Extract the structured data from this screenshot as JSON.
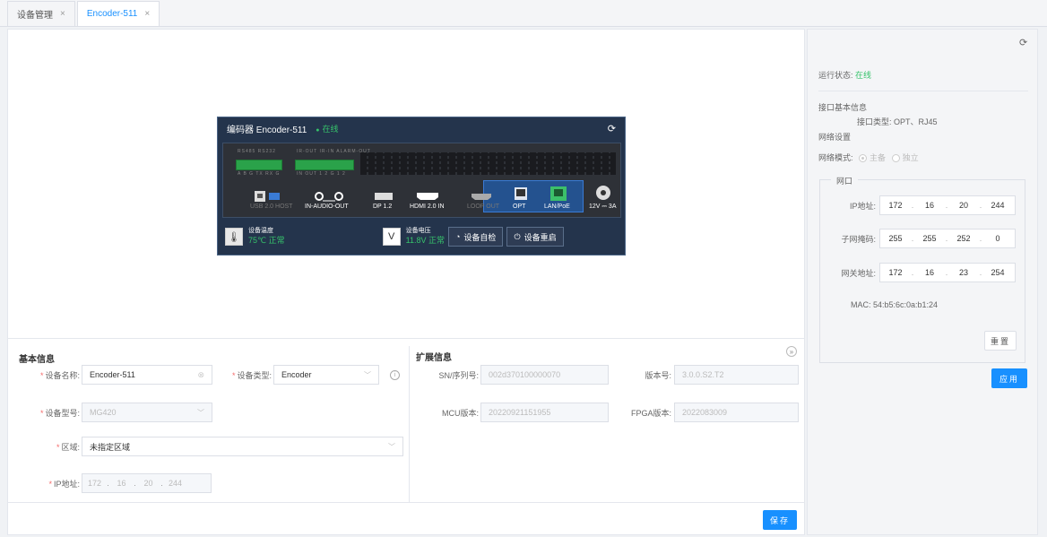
{
  "tabs": [
    {
      "label": "设备管理",
      "close": "×"
    },
    {
      "label": "Encoder-511",
      "close": "×"
    }
  ],
  "device": {
    "title": "编码器 Encoder-511",
    "status": "在线",
    "terminals": [
      {
        "top": "RS485 RS232",
        "bottom": "A B G TX RX G"
      },
      {
        "top": "IR-OUT IR-IN ALARM-OUT",
        "bottom": "IN OUT 1 2 G 1 2"
      }
    ],
    "ports": {
      "usb": "USB 2.0 HOST",
      "audio": "IN-AUDIO-OUT",
      "dp": "DP 1.2",
      "hdmi": "HDMI 2.0 IN",
      "loop": "LOOP OUT",
      "opt": "OPT",
      "lan": "LAN/PoE",
      "power": "12V ⎓ 3A"
    },
    "temp_label": "设备温度",
    "temp_value": "75℃ 正常",
    "volt_label": "设备电压",
    "volt_value": "11.8V 正常",
    "selfcheck_label": "设备自检",
    "reboot_label": "设备重启"
  },
  "basic": {
    "title": "基本信息",
    "name_label": "设备名称:",
    "name_value": "Encoder-511",
    "type_label": "设备类型:",
    "type_value": "Encoder",
    "model_label": "设备型号:",
    "model_value": "MG420",
    "region_label": "区域:",
    "region_value": "未指定区域",
    "ip_label": "IP地址:",
    "ip": [
      "172",
      "16",
      "20",
      "244"
    ]
  },
  "ext": {
    "title": "扩展信息",
    "sn_label": "SN/序列号:",
    "sn_value": "002d370100000070",
    "ver_label": "版本号:",
    "ver_value": "3.0.0.S2.T2",
    "mcu_label": "MCU版本:",
    "mcu_value": "20220921151955",
    "fpga_label": "FPGA版本:",
    "fpga_value": "2022083009"
  },
  "save_label": "保存",
  "side": {
    "run_label": "运行状态:",
    "run_value": "在线",
    "if_title": "接口基本信息",
    "if_type": "接口类型: OPT、RJ45",
    "net_title": "网络设置",
    "mode_label": "网络模式:",
    "mode_options": [
      "主备",
      "独立"
    ],
    "port_legend": "网口",
    "ip_label": "IP地址:",
    "ip": [
      "172",
      "16",
      "20",
      "244"
    ],
    "mask_label": "子网掩码:",
    "mask": [
      "255",
      "255",
      "252",
      "0"
    ],
    "gw_label": "网关地址:",
    "gw": [
      "172",
      "16",
      "23",
      "254"
    ],
    "mac": "MAC: 54:b5:6c:0a:b1:24",
    "reset_label": "重置",
    "apply_label": "应用"
  },
  "colors": {
    "accent": "#1890ff",
    "online": "#36c36b",
    "required": "#f56c6c",
    "panel": "#24344c"
  }
}
